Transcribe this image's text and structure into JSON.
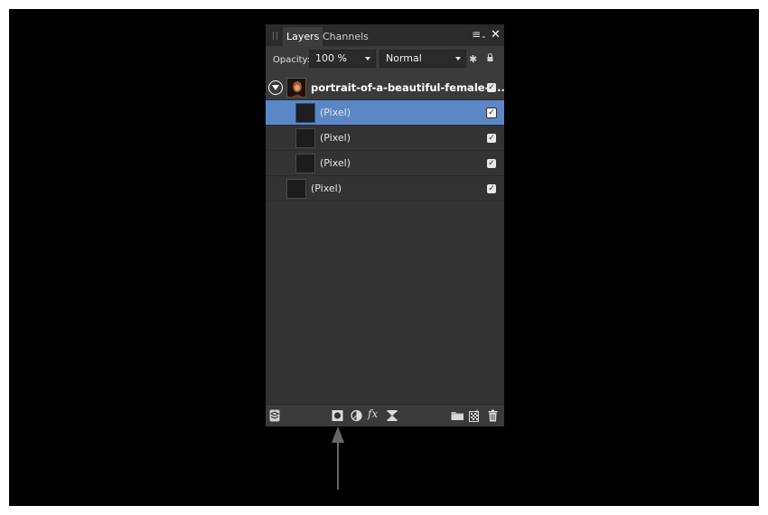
{
  "tabs": [
    {
      "label": "Layers",
      "active": true
    },
    {
      "label": "Channels",
      "active": false
    }
  ],
  "controls": {
    "opacity_label": "Opacity:",
    "opacity_value": "100 %",
    "blend_mode": "Normal"
  },
  "layers": {
    "group_name": "portrait-of-a-beautiful-female-f...",
    "items": [
      {
        "label": "(Pixel)",
        "selected": true,
        "visible": true
      },
      {
        "label": "(Pixel)",
        "selected": false,
        "visible": true
      },
      {
        "label": "(Pixel)",
        "selected": false,
        "visible": true
      },
      {
        "label": "(Pixel)",
        "selected": false,
        "visible": true
      }
    ]
  },
  "icons": {
    "panel_menu": "menu-icon",
    "close": "close-icon",
    "gear": "gear-icon",
    "lock": "lock-icon",
    "fx_label": "fx"
  },
  "colors": {
    "selection": "#5b87c7",
    "panel_bg": "#333333"
  }
}
